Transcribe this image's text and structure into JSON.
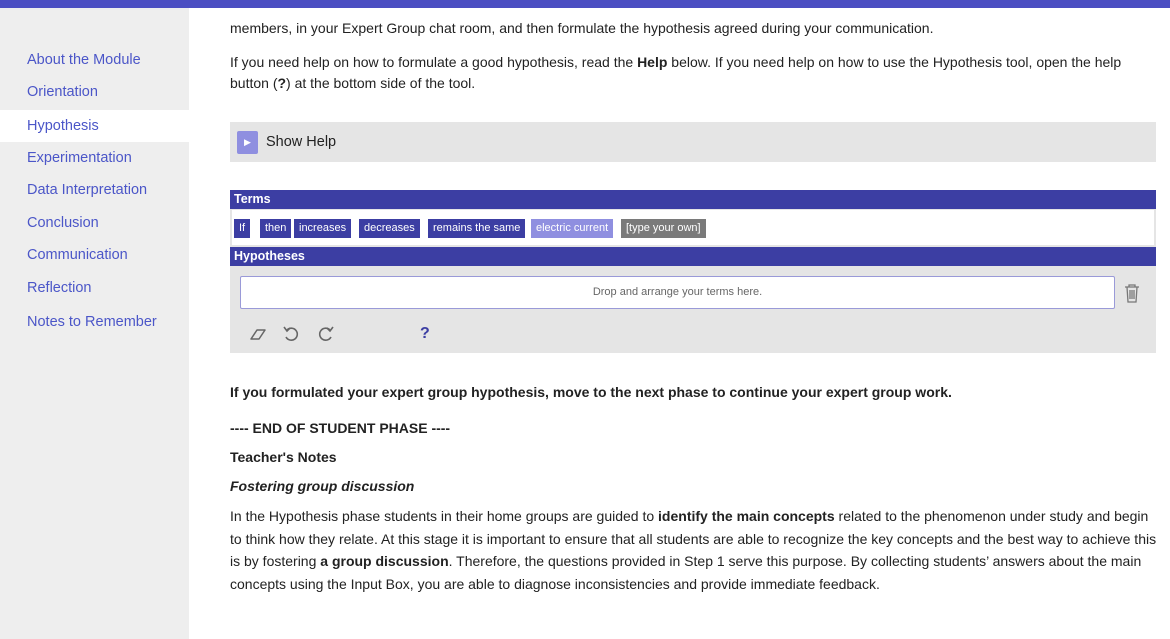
{
  "sidebar": {
    "items": [
      {
        "label": "About the Module"
      },
      {
        "label": "Orientation"
      },
      {
        "label": "Hypothesis"
      },
      {
        "label": "Experimentation"
      },
      {
        "label": "Data Interpretation"
      },
      {
        "label": "Conclusion"
      },
      {
        "label": "Communication"
      },
      {
        "label": "Reflection"
      },
      {
        "label": "Notes to Remember"
      }
    ],
    "active_index": 2
  },
  "main": {
    "intro_line": "members, in your Expert Group chat room, and then formulate the hypothesis agreed during your communication.",
    "help_para": {
      "p1": "If you need help on how to formulate a good hypothesis, read the ",
      "b1": "Help",
      "p2": " below. If you need help on how to use the Hypothesis tool, open the help button (",
      "b2": "?",
      "p3": ") at the bottom side of the tool."
    },
    "show_help_label": "Show Help",
    "tool": {
      "terms_header": "Terms",
      "terms": [
        "If",
        "then",
        "increases",
        "decreases",
        "remains the same",
        "electric current",
        "[type your own]"
      ],
      "hypotheses_header": "Hypotheses",
      "dropzone_text": "Drop and arrange your terms here.",
      "help_symbol": "?"
    },
    "next_phase_text": "If you formulated your expert group hypothesis, move to the next phase to continue your expert group work.",
    "end_phase_text": "---- END OF STUDENT PHASE ----",
    "teachers_notes_heading": "Teacher's Notes",
    "subheading": "Fostering group discussion",
    "body": {
      "s1": "In the Hypothesis phase students in their home groups are guided to ",
      "b1": "identify the main concepts",
      "s2": " related to the phenomenon under study and begin to think how they relate. At this stage it is important to ensure that all students are able to recognize the key concepts and the best way to achieve this is by fostering ",
      "b2": "a group discussion",
      "s3": ". Therefore, the questions provided in Step 1 serve this purpose. By collecting students’ answers about the main concepts using the Input Box, you are able to diagnose inconsistencies and provide immediate feedback."
    }
  },
  "colors": {
    "accent": "#4b4ec2",
    "tool_header": "#3c3ea3",
    "term_highlight": "#8f8fe0",
    "link": "#4b56c8"
  }
}
